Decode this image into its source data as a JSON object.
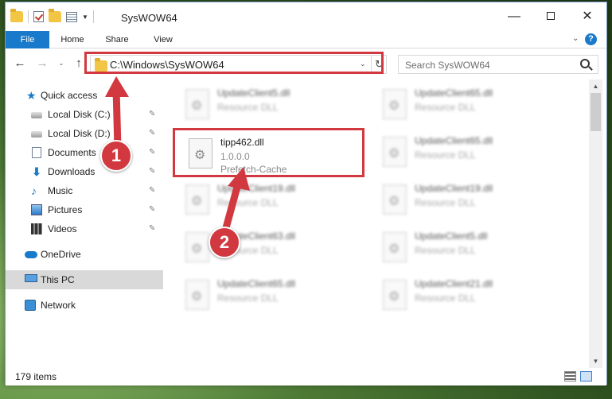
{
  "window": {
    "title": "SysWOW64",
    "controls": {
      "minimize": "—",
      "maximize": "",
      "close": "✕"
    }
  },
  "ribbon": {
    "tabs": [
      "File",
      "Home",
      "Share",
      "View"
    ],
    "caret": "⌄",
    "help": "?"
  },
  "nav": {
    "back": "←",
    "forward": "→",
    "recent": "⌄",
    "up": "↑"
  },
  "address": {
    "path": "C:\\Windows\\SysWOW64",
    "dropdown": "⌄",
    "refresh": "↻"
  },
  "search": {
    "placeholder": "Search SysWOW64"
  },
  "sidebar": {
    "items": [
      {
        "label": "Quick access",
        "icon": "star-icon",
        "pinned": false
      },
      {
        "label": "Local Disk (C:)",
        "icon": "drive-icon",
        "pinned": true
      },
      {
        "label": "Local Disk (D:)",
        "icon": "drive-icon",
        "pinned": true
      },
      {
        "label": "Documents",
        "icon": "documents-icon",
        "pinned": true
      },
      {
        "label": "Downloads",
        "icon": "downloads-icon",
        "pinned": true
      },
      {
        "label": "Music",
        "icon": "music-icon",
        "pinned": true
      },
      {
        "label": "Pictures",
        "icon": "pictures-icon",
        "pinned": true
      },
      {
        "label": "Videos",
        "icon": "videos-icon",
        "pinned": true
      },
      {
        "label": "OneDrive",
        "icon": "cloud-icon",
        "pinned": false
      },
      {
        "label": "This PC",
        "icon": "computer-icon",
        "pinned": false,
        "selected": true
      },
      {
        "label": "Network",
        "icon": "network-icon",
        "pinned": false
      }
    ],
    "pin_glyph": "📌"
  },
  "files": [
    {
      "name": "UpdateClient5.dll",
      "line2": "Resource DLL",
      "line3": "",
      "blurred": true
    },
    {
      "name": "UpdateClient65.dll",
      "line2": "Resource DLL",
      "line3": "",
      "blurred": true
    },
    {
      "name": "tipp462.dll",
      "line2": "1.0.0.0",
      "line3": "Prefetch-Cache",
      "blurred": false
    },
    {
      "name": "UpdateClient65.dll",
      "line2": "Resource DLL",
      "line3": "",
      "blurred": true
    },
    {
      "name": "UpdateClient19.dll",
      "line2": "Resource DLL",
      "line3": "",
      "blurred": true
    },
    {
      "name": "UpdateClient19.dll",
      "line2": "Resource DLL",
      "line3": "",
      "blurred": true
    },
    {
      "name": "UpdateClient63.dll",
      "line2": "Resource DLL",
      "line3": "",
      "blurred": true
    },
    {
      "name": "UpdateClient5.dll",
      "line2": "Resource DLL",
      "line3": "",
      "blurred": true
    },
    {
      "name": "UpdateClient65.dll",
      "line2": "Resource DLL",
      "line3": "",
      "blurred": true
    },
    {
      "name": "UpdateClient21.dll",
      "line2": "Resource DLL",
      "line3": "",
      "blurred": true
    }
  ],
  "status": {
    "item_count": "179 items"
  },
  "callouts": [
    "1",
    "2"
  ],
  "colors": {
    "accent": "#1979ca",
    "highlight": "#d2383f",
    "selected_bg": "#d9d9d9"
  }
}
